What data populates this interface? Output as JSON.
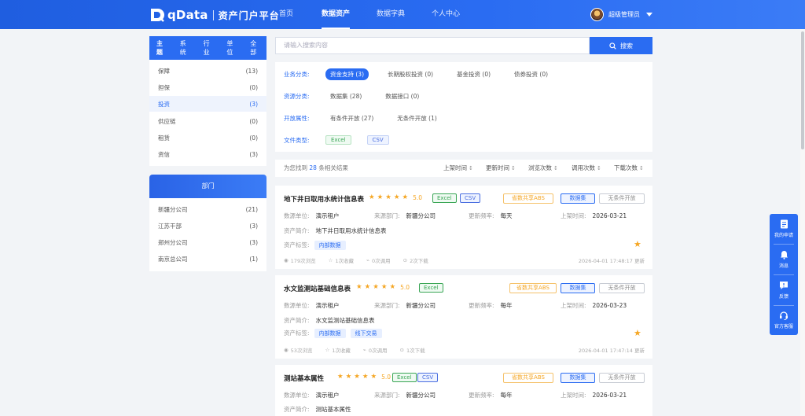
{
  "header": {
    "logo_text": "qData",
    "subtitle": "资产门户平台",
    "nav": [
      "首页",
      "数据资产",
      "数据字典",
      "个人中心"
    ],
    "active_nav": 1,
    "user_name": "超级管理员"
  },
  "left": {
    "tabs": [
      "主题",
      "系统",
      "行业",
      "单位",
      "全部"
    ],
    "categories": [
      {
        "label": "保障",
        "count": "(13)"
      },
      {
        "label": "担保",
        "count": "(0)"
      },
      {
        "label": "投资",
        "count": "(3)"
      },
      {
        "label": "供应链",
        "count": "(0)"
      },
      {
        "label": "租赁",
        "count": "(0)"
      },
      {
        "label": "资信",
        "count": "(3)"
      }
    ],
    "dept_title": "部门",
    "departments": [
      {
        "label": "新疆分公司",
        "count": "(21)"
      },
      {
        "label": "江苏干部",
        "count": "(3)"
      },
      {
        "label": "郑州分公司",
        "count": "(3)"
      },
      {
        "label": "南京总公司",
        "count": "(1)"
      }
    ]
  },
  "search": {
    "placeholder": "请输入搜索内容",
    "button": "搜索"
  },
  "filters": {
    "biz_label": "业务分类:",
    "biz_options": [
      "资金支持 (3)",
      "长期股权投资 (0)",
      "基金投资 (0)",
      "债券投资 (0)"
    ],
    "asset_label": "资源分类:",
    "asset_options": [
      "数据集 (28)",
      "数据接口 (0)"
    ],
    "open_label": "开放属性:",
    "open_options": [
      "有条件开放 (27)",
      "无条件开放 (1)"
    ],
    "filetype_label": "文件类型:",
    "filetype_options": [
      "Excel",
      "CSV"
    ]
  },
  "sortbar": {
    "prefix": "为您找到",
    "count": "28",
    "suffix": "条相关结果",
    "sorts": [
      "上架时间",
      "更新时间",
      "浏览次数",
      "调用次数",
      "下载次数"
    ]
  },
  "cards": [
    {
      "title": "地下井日取用水统计信息表",
      "score": "5.0",
      "tags": [
        "Excel",
        "CSV"
      ],
      "buttons": [
        "省数共享ABS",
        "数据集",
        "无条件开放"
      ],
      "unit_k": "数源单位:",
      "unit_v": "演示租户",
      "dept_k": "来源部门:",
      "dept_v": "新疆分公司",
      "freq_k": "更新频率:",
      "freq_v": "每天",
      "time_k": "上架时间:",
      "time_v": "2026-03-21",
      "desc_k": "资产简介:",
      "desc_v": "地下井日取用水统计信息表",
      "label_k": "资产标签:",
      "labels": [
        "内部数据"
      ],
      "stats": [
        "179次浏览",
        "1次收藏",
        "0次调用",
        "2次下载"
      ],
      "updated": "2026-04-01 17:48:17 更新"
    },
    {
      "title": "水文监测站基础信息表",
      "score": "5.0",
      "tags": [
        "Excel"
      ],
      "buttons": [
        "省数共享ABS",
        "数据集",
        "无条件开放"
      ],
      "unit_k": "数源单位:",
      "unit_v": "演示租户",
      "dept_k": "来源部门:",
      "dept_v": "新疆分公司",
      "freq_k": "更新频率:",
      "freq_v": "每年",
      "time_k": "上架时间:",
      "time_v": "2026-03-23",
      "desc_k": "资产简介:",
      "desc_v": "水文监测站基础信息表",
      "label_k": "资产标签:",
      "labels": [
        "内部数据",
        "线下交易"
      ],
      "stats": [
        "53次浏览",
        "1次收藏",
        "0次调用",
        "1次下载"
      ],
      "updated": "2026-04-01 17:47:14 更新"
    },
    {
      "title": "测站基本属性",
      "score": "5.0",
      "tags": [
        "Excel",
        "CSV"
      ],
      "buttons": [
        "省数共享ABS",
        "数据集",
        "无条件开放"
      ],
      "unit_k": "数源单位:",
      "unit_v": "演示租户",
      "dept_k": "来源部门:",
      "dept_v": "新疆分公司",
      "freq_k": "更新频率:",
      "freq_v": "每年",
      "time_k": "上架时间:",
      "time_v": "2026-03-21",
      "desc_k": "资产简介:",
      "desc_v": "测站基本属性"
    }
  ],
  "floatbar": [
    "我的申请",
    "消息",
    "反馈",
    "官方客服"
  ],
  "colors": {
    "primary": "#2a6cf2",
    "star": "#f5a623",
    "excel": "#3aa655"
  }
}
